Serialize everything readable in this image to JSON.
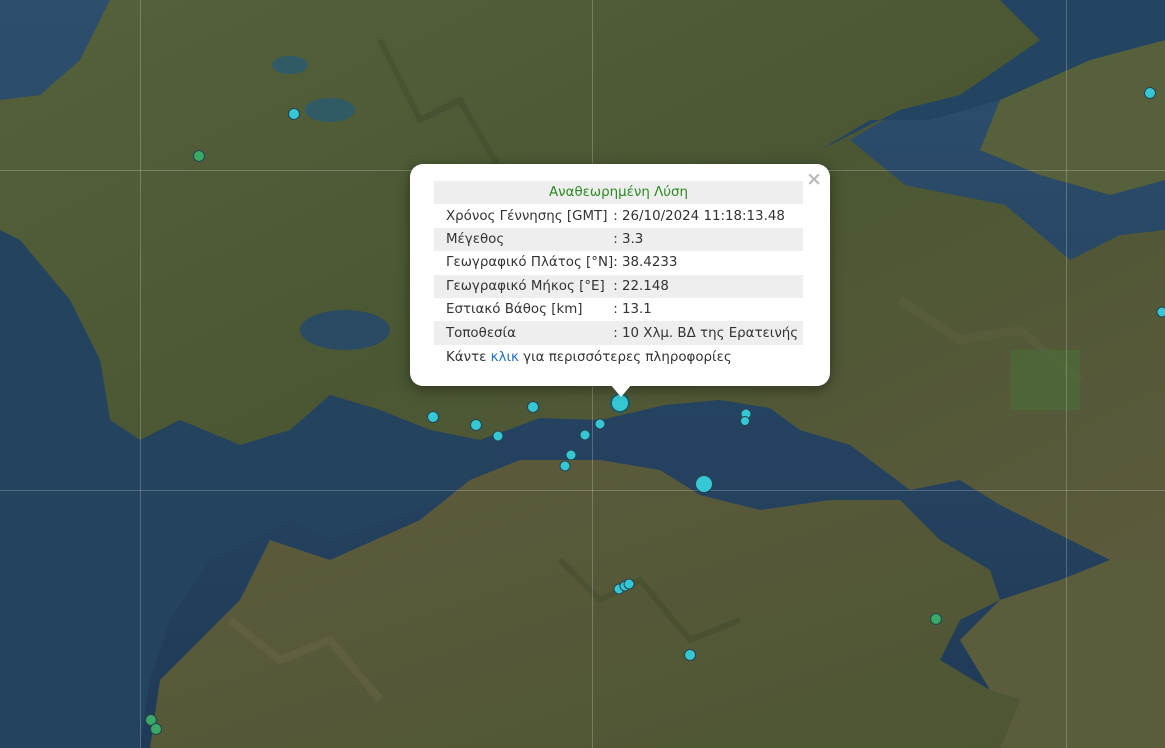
{
  "popup": {
    "title": "Αναθεωρημένη Λύση",
    "rows": [
      {
        "label": "Χρόνος Γέννησης [GMT]",
        "value": ": 26/10/2024 11:18:13.48"
      },
      {
        "label": "Μέγεθος",
        "value": ": 3.3"
      },
      {
        "label": "Γεωγραφικό Πλάτος [°N]",
        "value": ": 38.4233"
      },
      {
        "label": "Γεωγραφικό Μήκος [°E]",
        "value": ": 22.148"
      },
      {
        "label": "Εστιακό Βάθος [km]",
        "value": ": 13.1"
      },
      {
        "label": "Τοποθεσία",
        "value": ": 10 Χλμ. ΒΔ της Ερατεινής"
      }
    ],
    "more_prefix": "Κάντε",
    "more_link": "κλικ",
    "more_suffix": "για περισσότερες πληροφορίες",
    "close": "×"
  },
  "colors": {
    "recent_event": "#36c7d4",
    "older_event": "#3aa866",
    "title_text": "#2b8a22",
    "link_text": "#1f6fbf"
  }
}
